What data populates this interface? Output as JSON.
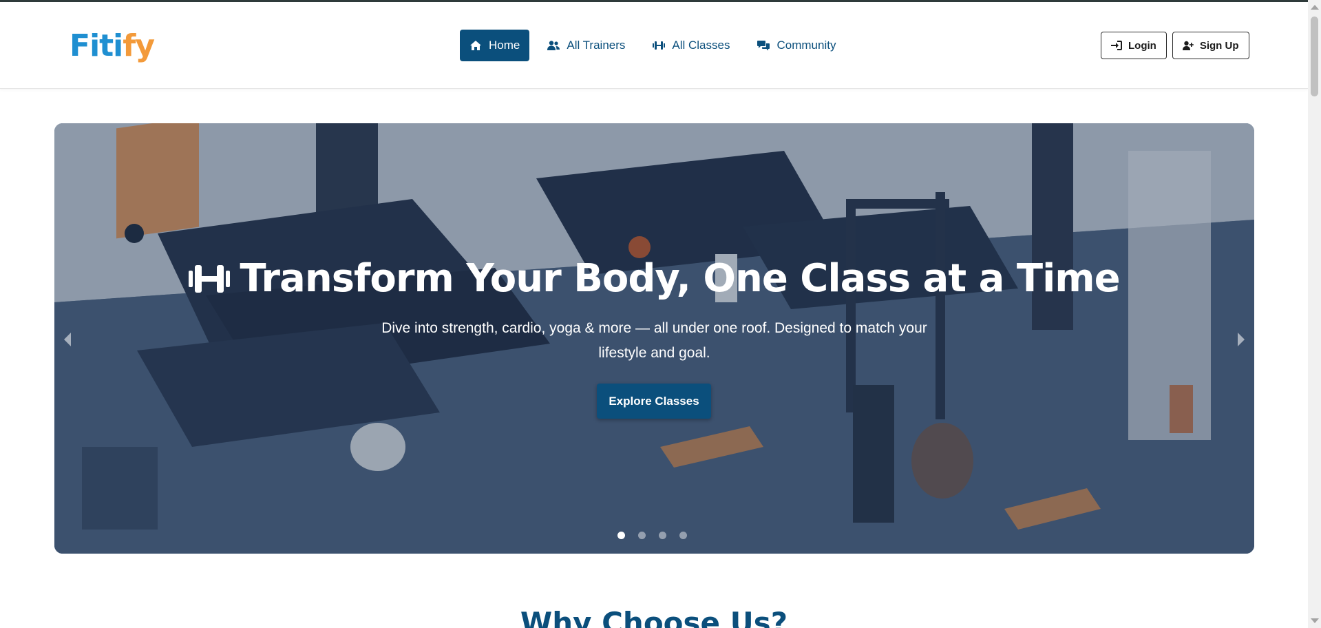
{
  "brand": {
    "name_part1": "F",
    "name_part2": "iti",
    "name_part3": "fy"
  },
  "nav": {
    "items": [
      {
        "label": "Home",
        "icon": "home-icon",
        "active": true
      },
      {
        "label": "All Trainers",
        "icon": "users-icon",
        "active": false
      },
      {
        "label": "All Classes",
        "icon": "dumbbell-icon",
        "active": false
      },
      {
        "label": "Community",
        "icon": "comments-icon",
        "active": false
      }
    ]
  },
  "auth": {
    "login_label": "Login",
    "signup_label": "Sign Up"
  },
  "hero": {
    "title": "Transform Your Body, One Class at a Time",
    "subtitle": "Dive into strength, cardio, yoga & more — all under one roof. Designed to match your lifestyle and goal.",
    "cta_label": "Explore Classes",
    "slide_count": 4,
    "active_slide": 1
  },
  "section": {
    "title": "Why Choose Us?"
  },
  "colors": {
    "primary": "#0b4f7c",
    "logo_blue": "#1f8fd1",
    "logo_orange": "#f39a3a"
  }
}
